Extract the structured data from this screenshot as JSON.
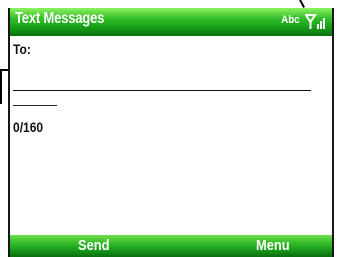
{
  "titlebar": {
    "title": "Text Messages",
    "input_mode": "Abc",
    "signal_icon": "signal-strength-icon"
  },
  "message": {
    "to_label": "To:",
    "to_value": "",
    "body_value": "",
    "char_count": "0/160"
  },
  "softkeys": {
    "left_label": "Send",
    "right_label": "Menu"
  },
  "colors": {
    "accent": "#2fbe28",
    "dark_accent": "#0f6f10",
    "text": "#111111"
  }
}
